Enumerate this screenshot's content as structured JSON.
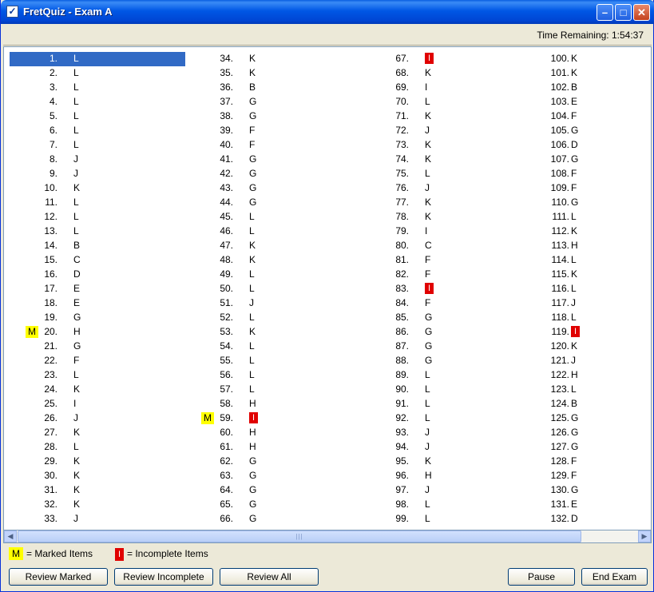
{
  "window": {
    "title": "FretQuiz - Exam A",
    "minimize": "–",
    "maximize": "□",
    "close": "✕"
  },
  "status": {
    "time_remaining": "Time Remaining: 1:54:37"
  },
  "answers": {
    "columns": [
      [
        {
          "n": "1.",
          "a": "L",
          "selected": true
        },
        {
          "n": "2.",
          "a": "L"
        },
        {
          "n": "3.",
          "a": "L"
        },
        {
          "n": "4.",
          "a": "L"
        },
        {
          "n": "5.",
          "a": "L"
        },
        {
          "n": "6.",
          "a": "L"
        },
        {
          "n": "7.",
          "a": "L"
        },
        {
          "n": "8.",
          "a": "J"
        },
        {
          "n": "9.",
          "a": "J"
        },
        {
          "n": "10.",
          "a": "K"
        },
        {
          "n": "11.",
          "a": "L"
        },
        {
          "n": "12.",
          "a": "L"
        },
        {
          "n": "13.",
          "a": "L"
        },
        {
          "n": "14.",
          "a": "B"
        },
        {
          "n": "15.",
          "a": "C"
        },
        {
          "n": "16.",
          "a": "D"
        },
        {
          "n": "17.",
          "a": "E"
        },
        {
          "n": "18.",
          "a": "E"
        },
        {
          "n": "19.",
          "a": "G"
        },
        {
          "n": "20.",
          "a": "H",
          "marked": true
        },
        {
          "n": "21.",
          "a": "G"
        },
        {
          "n": "22.",
          "a": "F"
        },
        {
          "n": "23.",
          "a": "L"
        },
        {
          "n": "24.",
          "a": "K"
        },
        {
          "n": "25.",
          "a": "I"
        },
        {
          "n": "26.",
          "a": "J"
        },
        {
          "n": "27.",
          "a": "K"
        },
        {
          "n": "28.",
          "a": "L"
        },
        {
          "n": "29.",
          "a": "K"
        },
        {
          "n": "30.",
          "a": "K"
        },
        {
          "n": "31.",
          "a": "K"
        },
        {
          "n": "32.",
          "a": "K"
        },
        {
          "n": "33.",
          "a": "J"
        }
      ],
      [
        {
          "n": "34.",
          "a": "K"
        },
        {
          "n": "35.",
          "a": "K"
        },
        {
          "n": "36.",
          "a": "B"
        },
        {
          "n": "37.",
          "a": "G"
        },
        {
          "n": "38.",
          "a": "G"
        },
        {
          "n": "39.",
          "a": "F"
        },
        {
          "n": "40.",
          "a": "F"
        },
        {
          "n": "41.",
          "a": "G"
        },
        {
          "n": "42.",
          "a": "G"
        },
        {
          "n": "43.",
          "a": "G"
        },
        {
          "n": "44.",
          "a": "G"
        },
        {
          "n": "45.",
          "a": "L"
        },
        {
          "n": "46.",
          "a": "L"
        },
        {
          "n": "47.",
          "a": "K"
        },
        {
          "n": "48.",
          "a": "K"
        },
        {
          "n": "49.",
          "a": "L"
        },
        {
          "n": "50.",
          "a": "L"
        },
        {
          "n": "51.",
          "a": "J"
        },
        {
          "n": "52.",
          "a": "L"
        },
        {
          "n": "53.",
          "a": "K"
        },
        {
          "n": "54.",
          "a": "L"
        },
        {
          "n": "55.",
          "a": "L"
        },
        {
          "n": "56.",
          "a": "L"
        },
        {
          "n": "57.",
          "a": "L"
        },
        {
          "n": "58.",
          "a": "H"
        },
        {
          "n": "59.",
          "a": "I",
          "marked": true,
          "incomplete": true
        },
        {
          "n": "60.",
          "a": "H"
        },
        {
          "n": "61.",
          "a": "H"
        },
        {
          "n": "62.",
          "a": "G"
        },
        {
          "n": "63.",
          "a": "G"
        },
        {
          "n": "64.",
          "a": "G"
        },
        {
          "n": "65.",
          "a": "G"
        },
        {
          "n": "66.",
          "a": "G"
        }
      ],
      [
        {
          "n": "67.",
          "a": "I",
          "incomplete": true
        },
        {
          "n": "68.",
          "a": "K"
        },
        {
          "n": "69.",
          "a": "I"
        },
        {
          "n": "70.",
          "a": "L"
        },
        {
          "n": "71.",
          "a": "K"
        },
        {
          "n": "72.",
          "a": "J"
        },
        {
          "n": "73.",
          "a": "K"
        },
        {
          "n": "74.",
          "a": "K"
        },
        {
          "n": "75.",
          "a": "L"
        },
        {
          "n": "76.",
          "a": "J"
        },
        {
          "n": "77.",
          "a": "K"
        },
        {
          "n": "78.",
          "a": "K"
        },
        {
          "n": "79.",
          "a": "I"
        },
        {
          "n": "80.",
          "a": "C"
        },
        {
          "n": "81.",
          "a": "F"
        },
        {
          "n": "82.",
          "a": "F"
        },
        {
          "n": "83.",
          "a": "I",
          "incomplete": true
        },
        {
          "n": "84.",
          "a": "F"
        },
        {
          "n": "85.",
          "a": "G"
        },
        {
          "n": "86.",
          "a": "G"
        },
        {
          "n": "87.",
          "a": "G"
        },
        {
          "n": "88.",
          "a": "G"
        },
        {
          "n": "89.",
          "a": "L"
        },
        {
          "n": "90.",
          "a": "L"
        },
        {
          "n": "91.",
          "a": "L"
        },
        {
          "n": "92.",
          "a": "L"
        },
        {
          "n": "93.",
          "a": "J"
        },
        {
          "n": "94.",
          "a": "J"
        },
        {
          "n": "95.",
          "a": "K"
        },
        {
          "n": "96.",
          "a": "H"
        },
        {
          "n": "97.",
          "a": "J"
        },
        {
          "n": "98.",
          "a": "L"
        },
        {
          "n": "99.",
          "a": "L"
        }
      ],
      [
        {
          "n": "100.",
          "a": "K"
        },
        {
          "n": "101.",
          "a": "K"
        },
        {
          "n": "102.",
          "a": "B"
        },
        {
          "n": "103.",
          "a": "E"
        },
        {
          "n": "104.",
          "a": "F"
        },
        {
          "n": "105.",
          "a": "G"
        },
        {
          "n": "106.",
          "a": "D"
        },
        {
          "n": "107.",
          "a": "G"
        },
        {
          "n": "108.",
          "a": "F"
        },
        {
          "n": "109.",
          "a": "F"
        },
        {
          "n": "110.",
          "a": "G"
        },
        {
          "n": "111.",
          "a": "L"
        },
        {
          "n": "112.",
          "a": "K"
        },
        {
          "n": "113.",
          "a": "H"
        },
        {
          "n": "114.",
          "a": "L"
        },
        {
          "n": "115.",
          "a": "K"
        },
        {
          "n": "116.",
          "a": "L"
        },
        {
          "n": "117.",
          "a": "J"
        },
        {
          "n": "118.",
          "a": "L"
        },
        {
          "n": "119.",
          "a": "I",
          "incomplete": true
        },
        {
          "n": "120.",
          "a": "K"
        },
        {
          "n": "121.",
          "a": "J"
        },
        {
          "n": "122.",
          "a": "H"
        },
        {
          "n": "123.",
          "a": "L"
        },
        {
          "n": "124.",
          "a": "B"
        },
        {
          "n": "125.",
          "a": "G"
        },
        {
          "n": "126.",
          "a": "G"
        },
        {
          "n": "127.",
          "a": "G"
        },
        {
          "n": "128.",
          "a": "F"
        },
        {
          "n": "129.",
          "a": "F"
        },
        {
          "n": "130.",
          "a": "G"
        },
        {
          "n": "131.",
          "a": "E"
        },
        {
          "n": "132.",
          "a": "D"
        }
      ]
    ],
    "mark_symbol": "M"
  },
  "scrollbar": {
    "left_arrow": "◀",
    "right_arrow": "▶",
    "grip": "|||"
  },
  "legend": {
    "marked_symbol": "M",
    "marked_text": "= Marked Items",
    "incomplete_symbol": "I",
    "incomplete_text": "= Incomplete Items"
  },
  "buttons": {
    "review_marked": "Review Marked",
    "review_incomplete": "Review Incomplete",
    "review_all": "Review All",
    "pause": "Pause",
    "end_exam": "End Exam"
  },
  "colors": {
    "selection": "#316ac5",
    "marked": "#ffff00",
    "incomplete": "#e00000",
    "title_bar": "#0054e3"
  }
}
